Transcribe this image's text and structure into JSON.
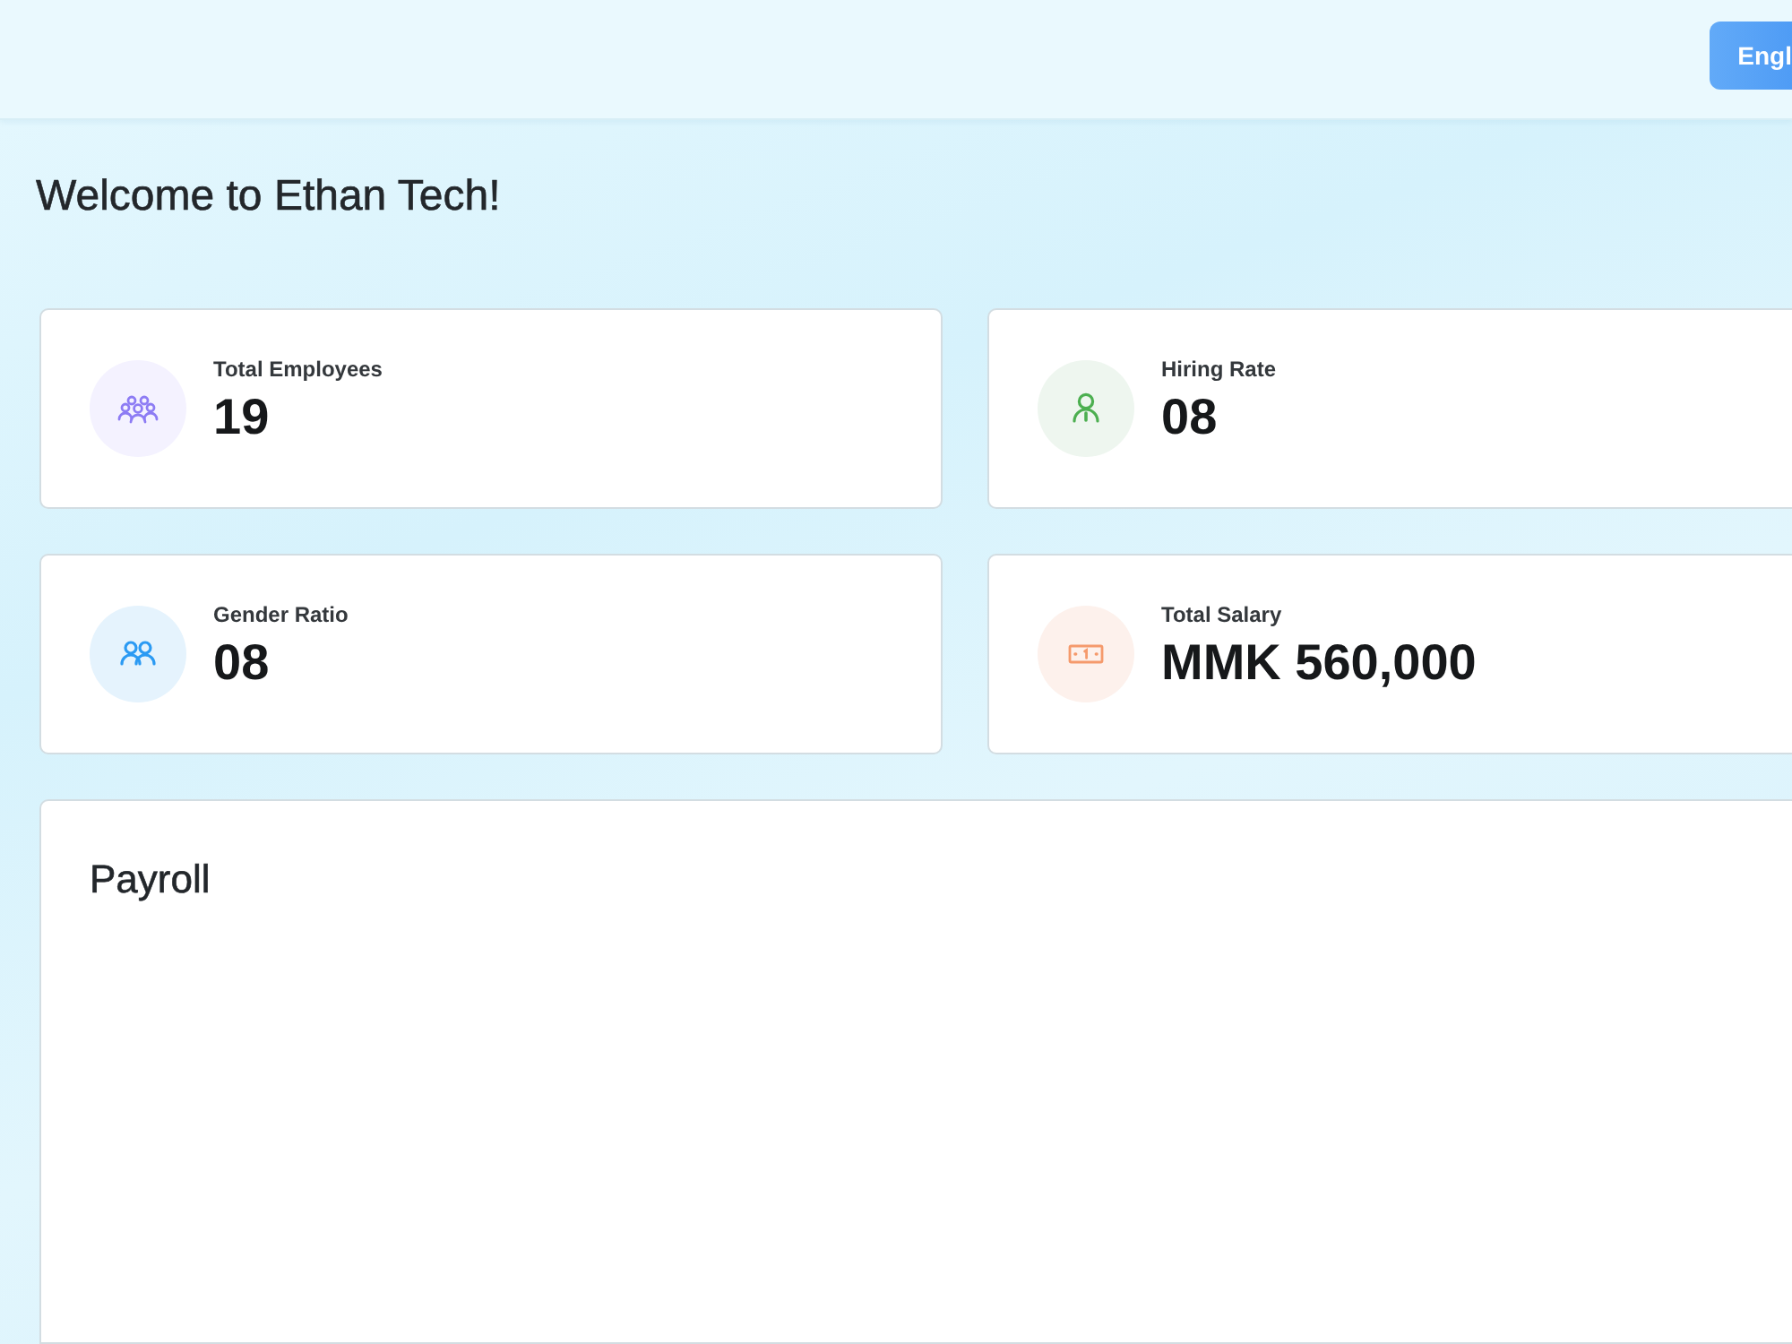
{
  "header": {
    "language_button": "Engl"
  },
  "welcome": "Welcome to Ethan Tech!",
  "stats": [
    {
      "kind": "employees",
      "label": "Total Employees",
      "value": "19"
    },
    {
      "kind": "hiring",
      "label": "Hiring Rate",
      "value": "08"
    },
    {
      "kind": "gender",
      "label": "Gender Ratio",
      "value": "08"
    },
    {
      "kind": "salary",
      "label": "Total Salary",
      "value": "MMK 560,000"
    }
  ],
  "payroll": {
    "title": "Payroll"
  }
}
